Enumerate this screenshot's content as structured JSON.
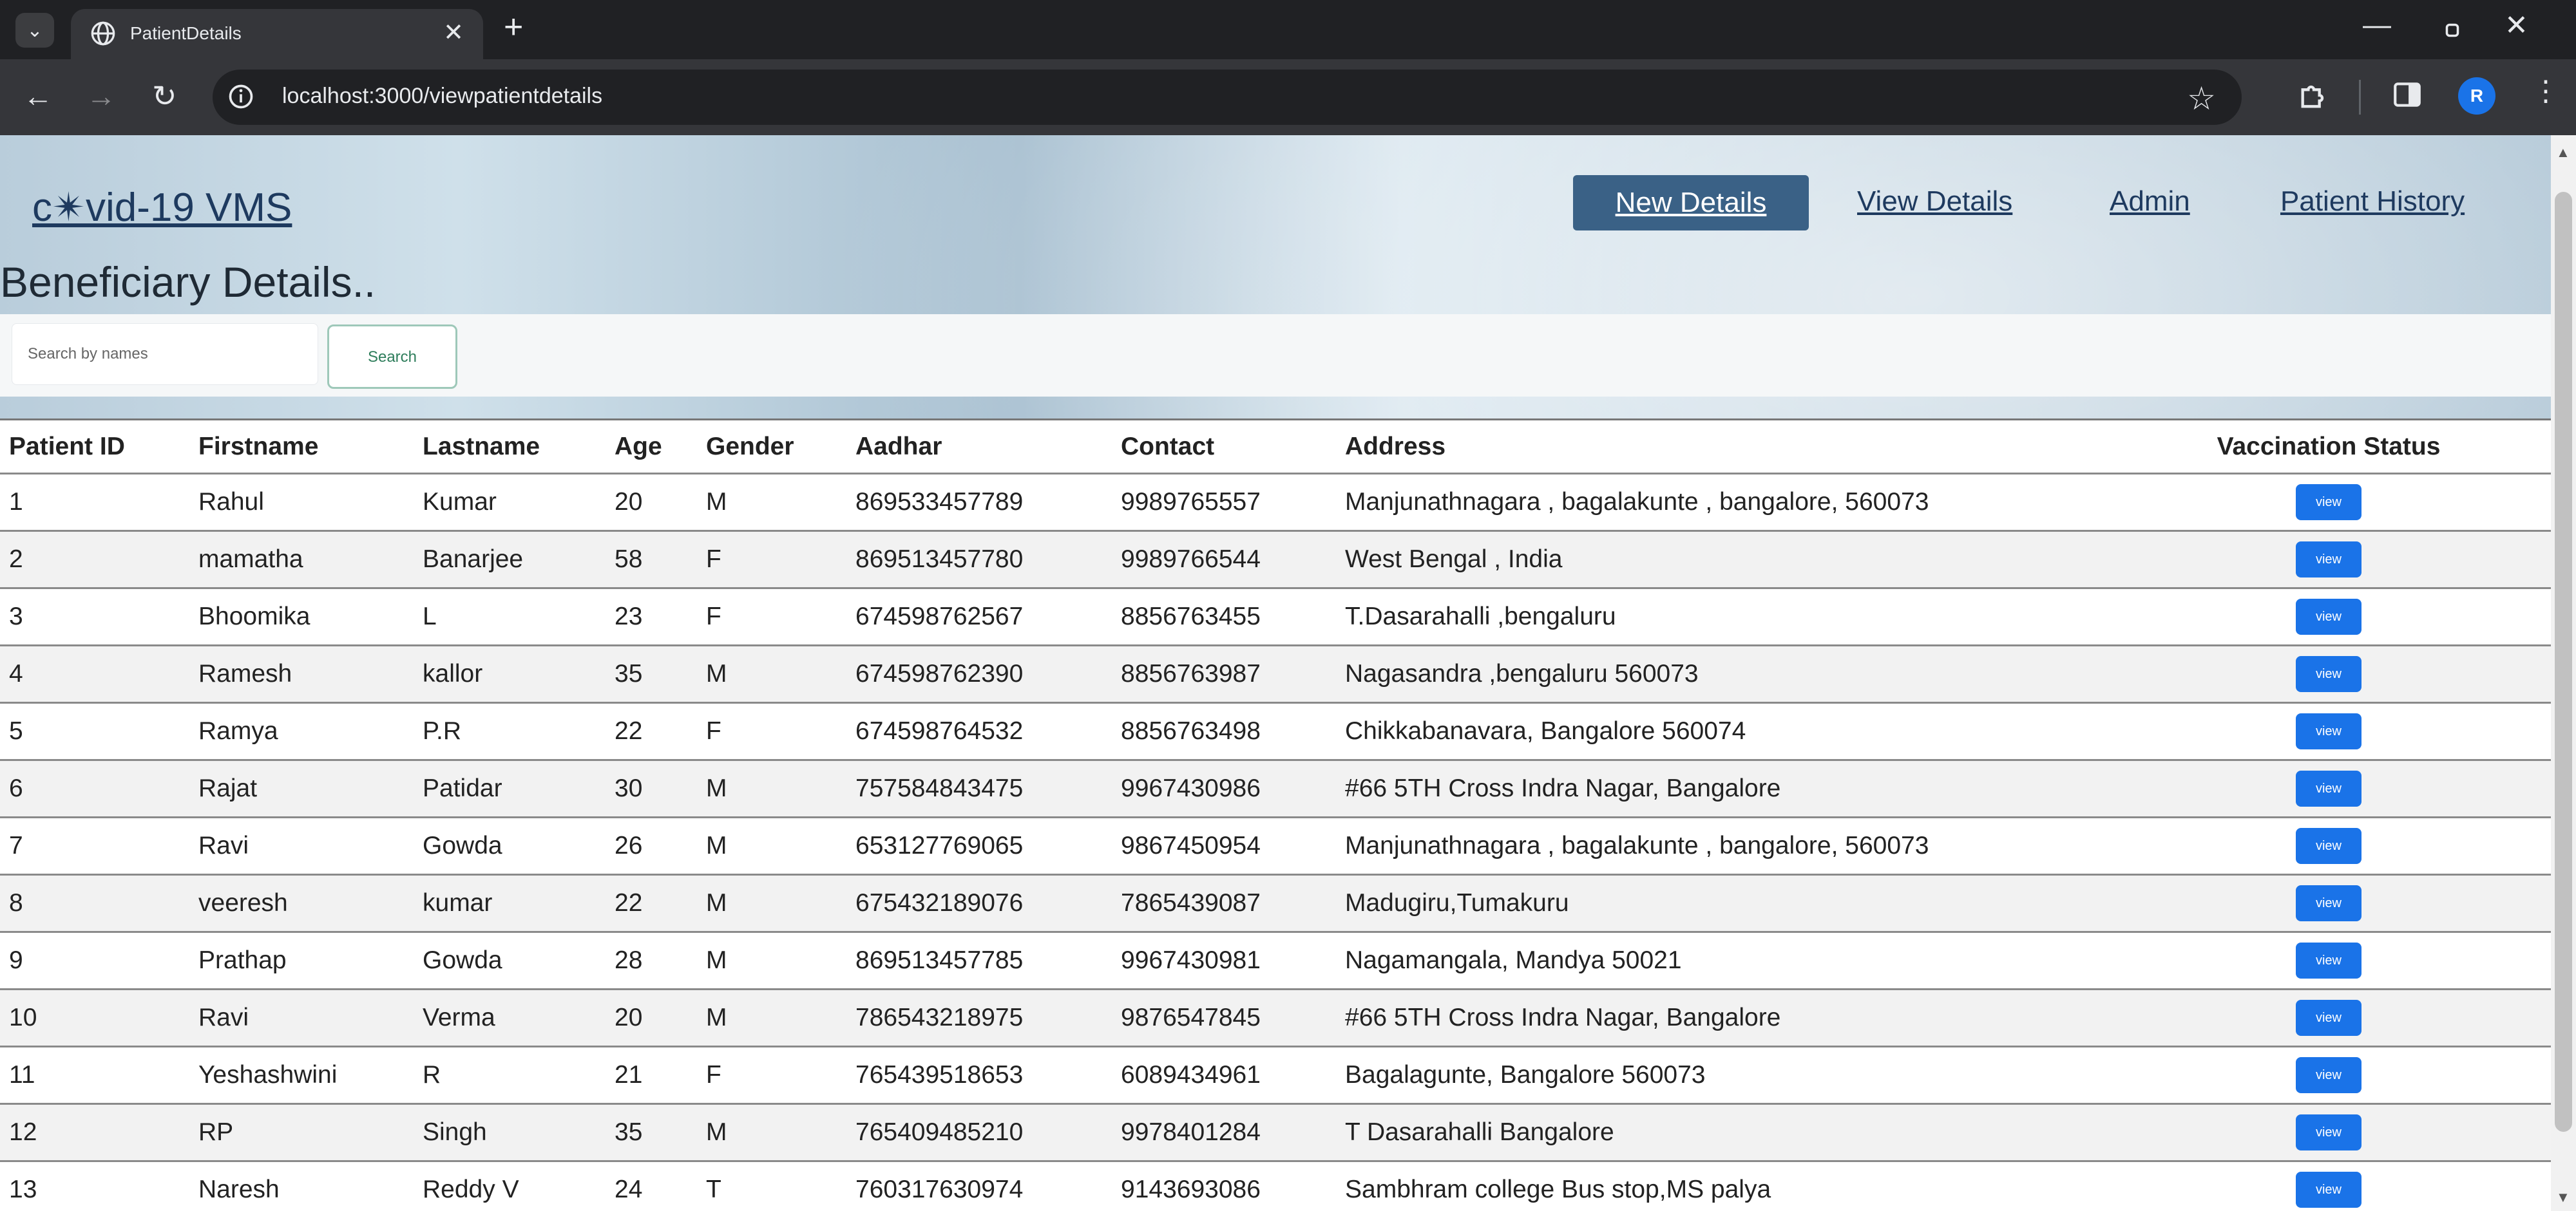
{
  "browser": {
    "tab_title": "PatientDetails",
    "url": "localhost:3000/viewpatientdetails",
    "profile_initial": "R",
    "icons": {
      "tab_search": "chevron-down-icon",
      "tab_favicon": "globe-icon",
      "tab_close": "close-icon",
      "new_tab": "plus-icon",
      "back": "arrow-left-icon",
      "forward": "arrow-right-icon",
      "reload": "reload-icon",
      "site_info": "info-icon",
      "bookmark": "star-icon",
      "extensions": "puzzle-icon",
      "side_panel": "side-panel-icon",
      "menu": "kebab-menu-icon",
      "minimize": "minimize-icon",
      "restore": "restore-icon",
      "close_window": "close-icon"
    }
  },
  "header": {
    "logo": "c✴vid-19 VMS",
    "nav": {
      "new_details": "New Details",
      "view_details": "View Details",
      "admin": "Admin",
      "patient_history": "Patient History"
    },
    "active_color": "#3a6186"
  },
  "page_heading": "Beneficiary Details..",
  "search": {
    "placeholder": "Search by names",
    "button": "Search"
  },
  "table": {
    "columns": [
      "Patient ID",
      "Firstname",
      "Lastname",
      "Age",
      "Gender",
      "Aadhar",
      "Contact",
      "Address",
      "Vaccination Status"
    ],
    "action_label": "view",
    "action_color": "#1a73e8",
    "rows": [
      [
        "1",
        "Rahul",
        "Kumar",
        "20",
        "M",
        "869533457789",
        "9989765557",
        "Manjunathnagara , bagalakunte , bangalore, 560073"
      ],
      [
        "2",
        "mamatha",
        "Banarjee",
        "58",
        "F",
        "869513457780",
        "9989766544",
        "West Bengal , India"
      ],
      [
        "3",
        "Bhoomika",
        "L",
        "23",
        "F",
        "674598762567",
        "8856763455",
        "T.Dasarahalli ,bengaluru"
      ],
      [
        "4",
        "Ramesh",
        "kallor",
        "35",
        "M",
        "674598762390",
        "8856763987",
        "Nagasandra ,bengaluru 560073"
      ],
      [
        "5",
        "Ramya",
        "P.R",
        "22",
        "F",
        "674598764532",
        "8856763498",
        "Chikkabanavara, Bangalore 560074"
      ],
      [
        "6",
        "Rajat",
        "Patidar",
        "30",
        "M",
        "757584843475",
        "9967430986",
        "#66 5TH Cross Indra Nagar, Bangalore"
      ],
      [
        "7",
        "Ravi",
        "Gowda",
        "26",
        "M",
        "653127769065",
        "9867450954",
        "Manjunathnagara , bagalakunte , bangalore, 560073"
      ],
      [
        "8",
        "veeresh",
        "kumar",
        "22",
        "M",
        "675432189076",
        "7865439087",
        "Madugiru,Tumakuru"
      ],
      [
        "9",
        "Prathap",
        "Gowda",
        "28",
        "M",
        "869513457785",
        "9967430981",
        "Nagamangala, Mandya 50021"
      ],
      [
        "10",
        "Ravi",
        "Verma",
        "20",
        "M",
        "786543218975",
        "9876547845",
        "#66 5TH Cross Indra Nagar, Bangalore"
      ],
      [
        "11",
        "Yeshashwini",
        "R",
        "21",
        "F",
        "765439518653",
        "6089434961",
        "Bagalagunte, Bangalore 560073"
      ],
      [
        "12",
        "RP",
        "Singh",
        "35",
        "M",
        "765409485210",
        "9978401284",
        "T Dasarahalli Bangalore"
      ],
      [
        "13",
        "Naresh",
        "Reddy V",
        "24",
        "T",
        "760317630974",
        "9143693086",
        "Sambhram college Bus stop,MS palya"
      ]
    ]
  }
}
